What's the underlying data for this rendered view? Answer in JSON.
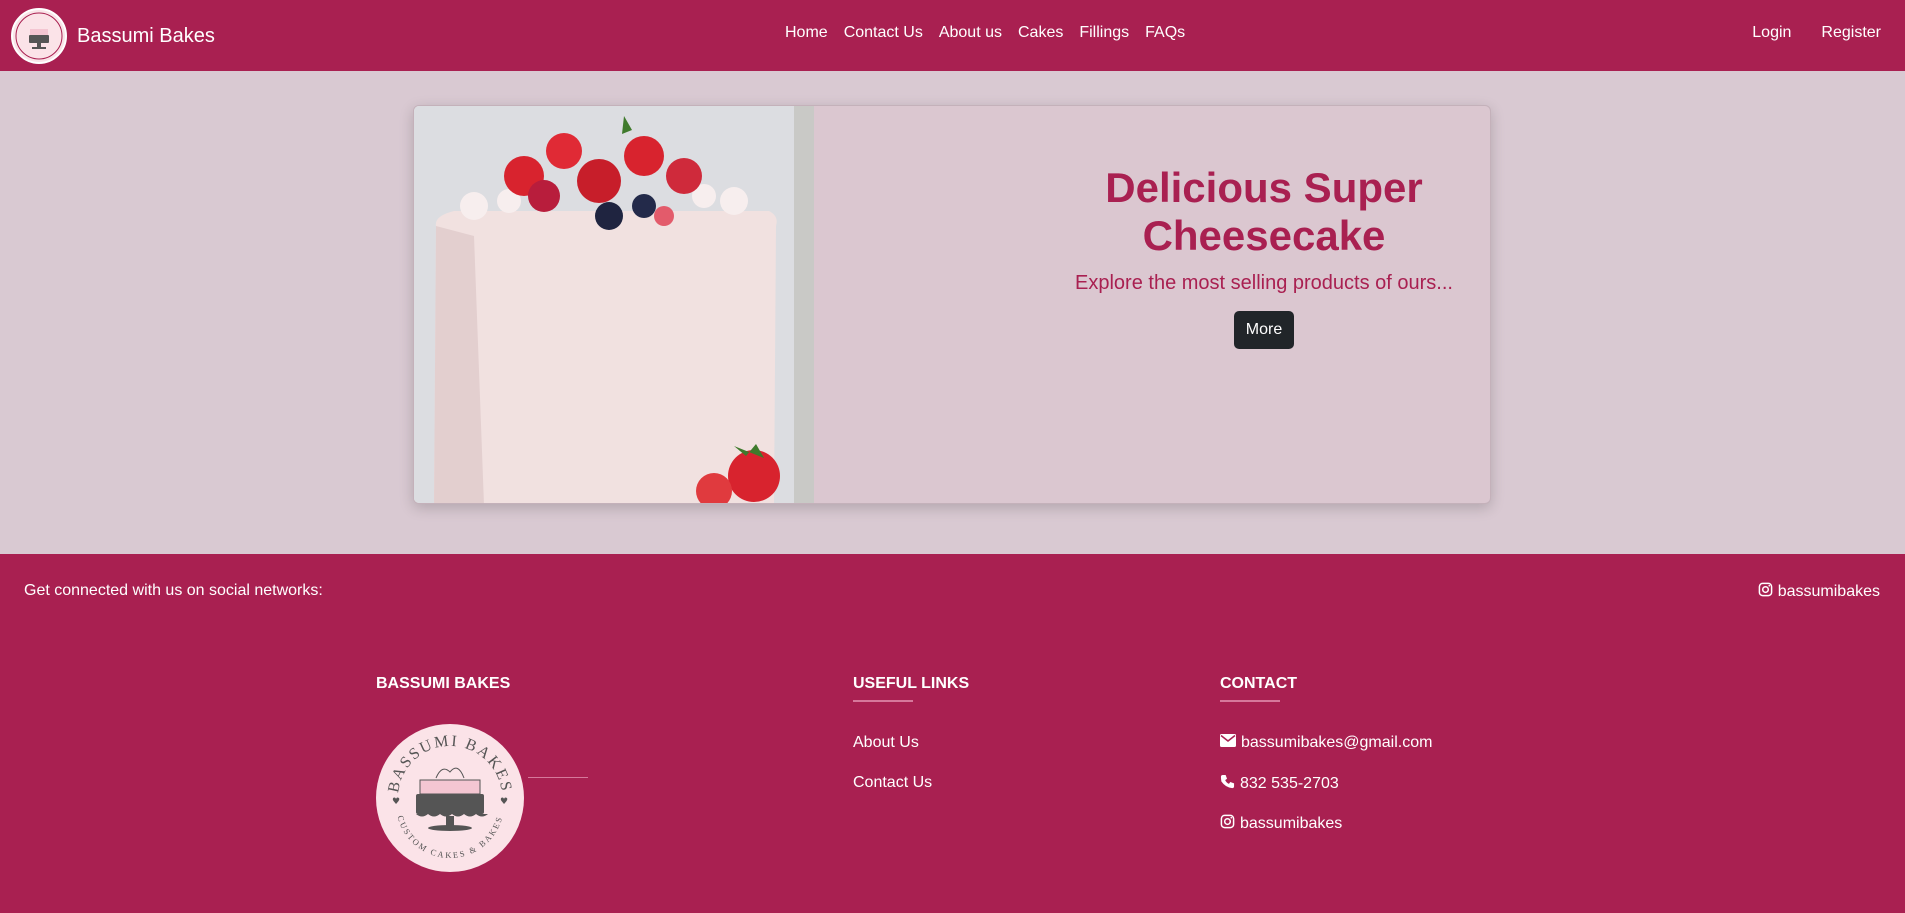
{
  "navbar": {
    "brand": "Bassumi Bakes",
    "links": [
      "Home",
      "Contact Us",
      "About us",
      "Cakes",
      "Fillings",
      "FAQs"
    ],
    "login": "Login",
    "register": "Register"
  },
  "hero": {
    "title": "Delicious Super Cheesecake",
    "subtitle": "Explore the most selling products of ours...",
    "button": "More"
  },
  "footer": {
    "social_text": "Get connected with us on social networks:",
    "social_handle": "bassumibakes",
    "col1_title": "BASSUMI BAKES",
    "col2_title": "USEFUL LINKS",
    "col3_title": "CONTACT",
    "useful_links": [
      "About Us",
      "Contact Us"
    ],
    "email": "bassumibakes@gmail.com",
    "phone": "832 535-2703",
    "instagram": "bassumibakes",
    "logo_top_text": "BASSUMI BAKES",
    "logo_bottom_text": "CUSTOM CAKES & BAKES"
  },
  "colors": {
    "primary": "#a92051",
    "background": "#d9c9d2",
    "button": "#212529"
  },
  "icons": {
    "instagram": "instagram-icon",
    "email": "envelope-icon",
    "phone": "phone-icon"
  }
}
